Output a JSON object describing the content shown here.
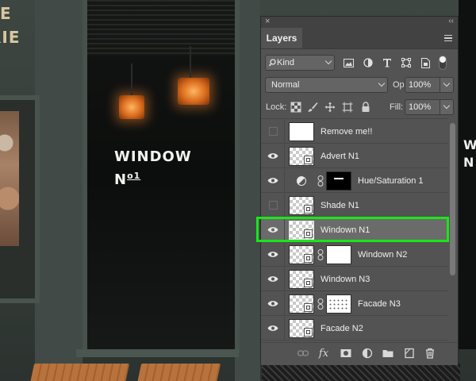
{
  "background": {
    "sign_text_line1": "E",
    "sign_text_line2": "RIE",
    "window_text_line1": "WINDOW",
    "window_text_line2": "N",
    "window_text_line2_sup": "o1",
    "right_window_text": "W\nN"
  },
  "panel": {
    "close_glyph": "×",
    "collapse_glyph": "‹‹",
    "tab_label": "Layers",
    "filter": {
      "kind_label": "Kind",
      "icons": [
        "pixel-filter-icon",
        "adjustment-filter-icon",
        "type-filter-icon",
        "shape-filter-icon",
        "smart-object-filter-icon",
        "filter-toggle-icon"
      ]
    },
    "blend_mode": "Normal",
    "opacity_label": "Opacity:",
    "opacity_value": "100%",
    "lock_label": "Lock:",
    "fill_label": "Fill:",
    "fill_value": "100%",
    "layers": [
      {
        "name": "Remove me!!",
        "visible": false,
        "thumb": "white",
        "selected": false
      },
      {
        "name": "Advert N1",
        "visible": true,
        "thumb": "checker-so",
        "selected": false
      },
      {
        "name": "Hue/Saturation 1",
        "visible": true,
        "thumb": "adjustment",
        "selected": false
      },
      {
        "name": "Shade N1",
        "visible": false,
        "thumb": "checker-so",
        "selected": false
      },
      {
        "name": "Windown N1",
        "visible": true,
        "thumb": "checker-so",
        "selected": true
      },
      {
        "name": "Windown N2",
        "visible": true,
        "thumb": "checker-so-mask",
        "selected": false
      },
      {
        "name": "Windown N3",
        "visible": true,
        "thumb": "checker-so",
        "selected": false
      },
      {
        "name": "Facade N3",
        "visible": true,
        "thumb": "checker-so-mask-dots",
        "selected": false
      },
      {
        "name": "Facade N2",
        "visible": true,
        "thumb": "checker-so",
        "selected": false
      }
    ],
    "footer": {
      "fx_label": "fx"
    }
  },
  "colors": {
    "highlight": "#19e619",
    "panel_bg": "#535353",
    "selected_row": "#6b6b6b"
  }
}
